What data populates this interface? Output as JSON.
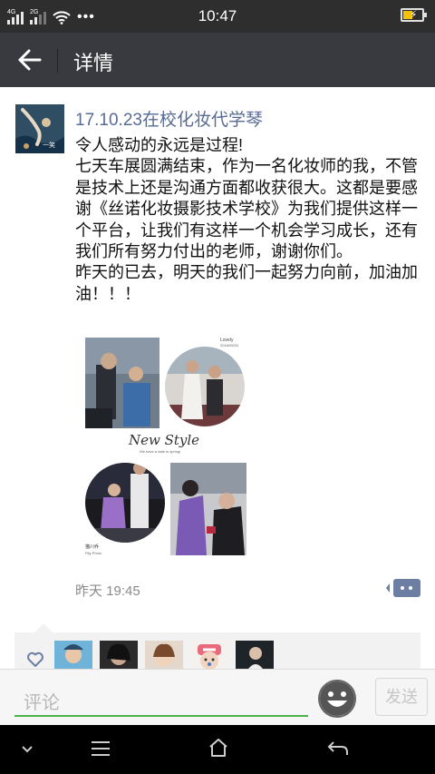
{
  "status_bar": {
    "network_1": "4G",
    "network_2": "2G",
    "time": "10:47",
    "more_dots": "•••"
  },
  "title_bar": {
    "title": "详情"
  },
  "post": {
    "author": "17.10.23在校化妆代学琴",
    "avatar_caption": "一笑",
    "text": "令人感动的永远是过程!\n七天车展圆满结束，作为一名化妆师的我，不管是技术上还是沟通方面都收获很大。这都是要感谢《丝诺化妆摄影技术学校》为我们提供这样一个平台，让我们有这样一个机会学习成长，还有我们所有努力付出的老师，谢谢你们。\n昨天的已去，明天的我们一起努力向前，加油加油！！！",
    "timestamp": "昨天 19:45",
    "photo": {
      "label_lovely": "Lovely",
      "label_date": "2018/05/04",
      "title": "New Style",
      "subtitle": "We have a date in spring!",
      "caption_cn": "猫川乔",
      "caption_en": "Pity Photo"
    }
  },
  "likes": {
    "count_avatars": 5
  },
  "comment_bar": {
    "placeholder": "评论",
    "send_label": "发送"
  },
  "colors": {
    "status_bg": "#2e2e2e",
    "titlebar_bg": "#393a3f",
    "author_link": "#586b95",
    "input_underline": "#49b24a",
    "comment_button": "#6d7ea3"
  }
}
